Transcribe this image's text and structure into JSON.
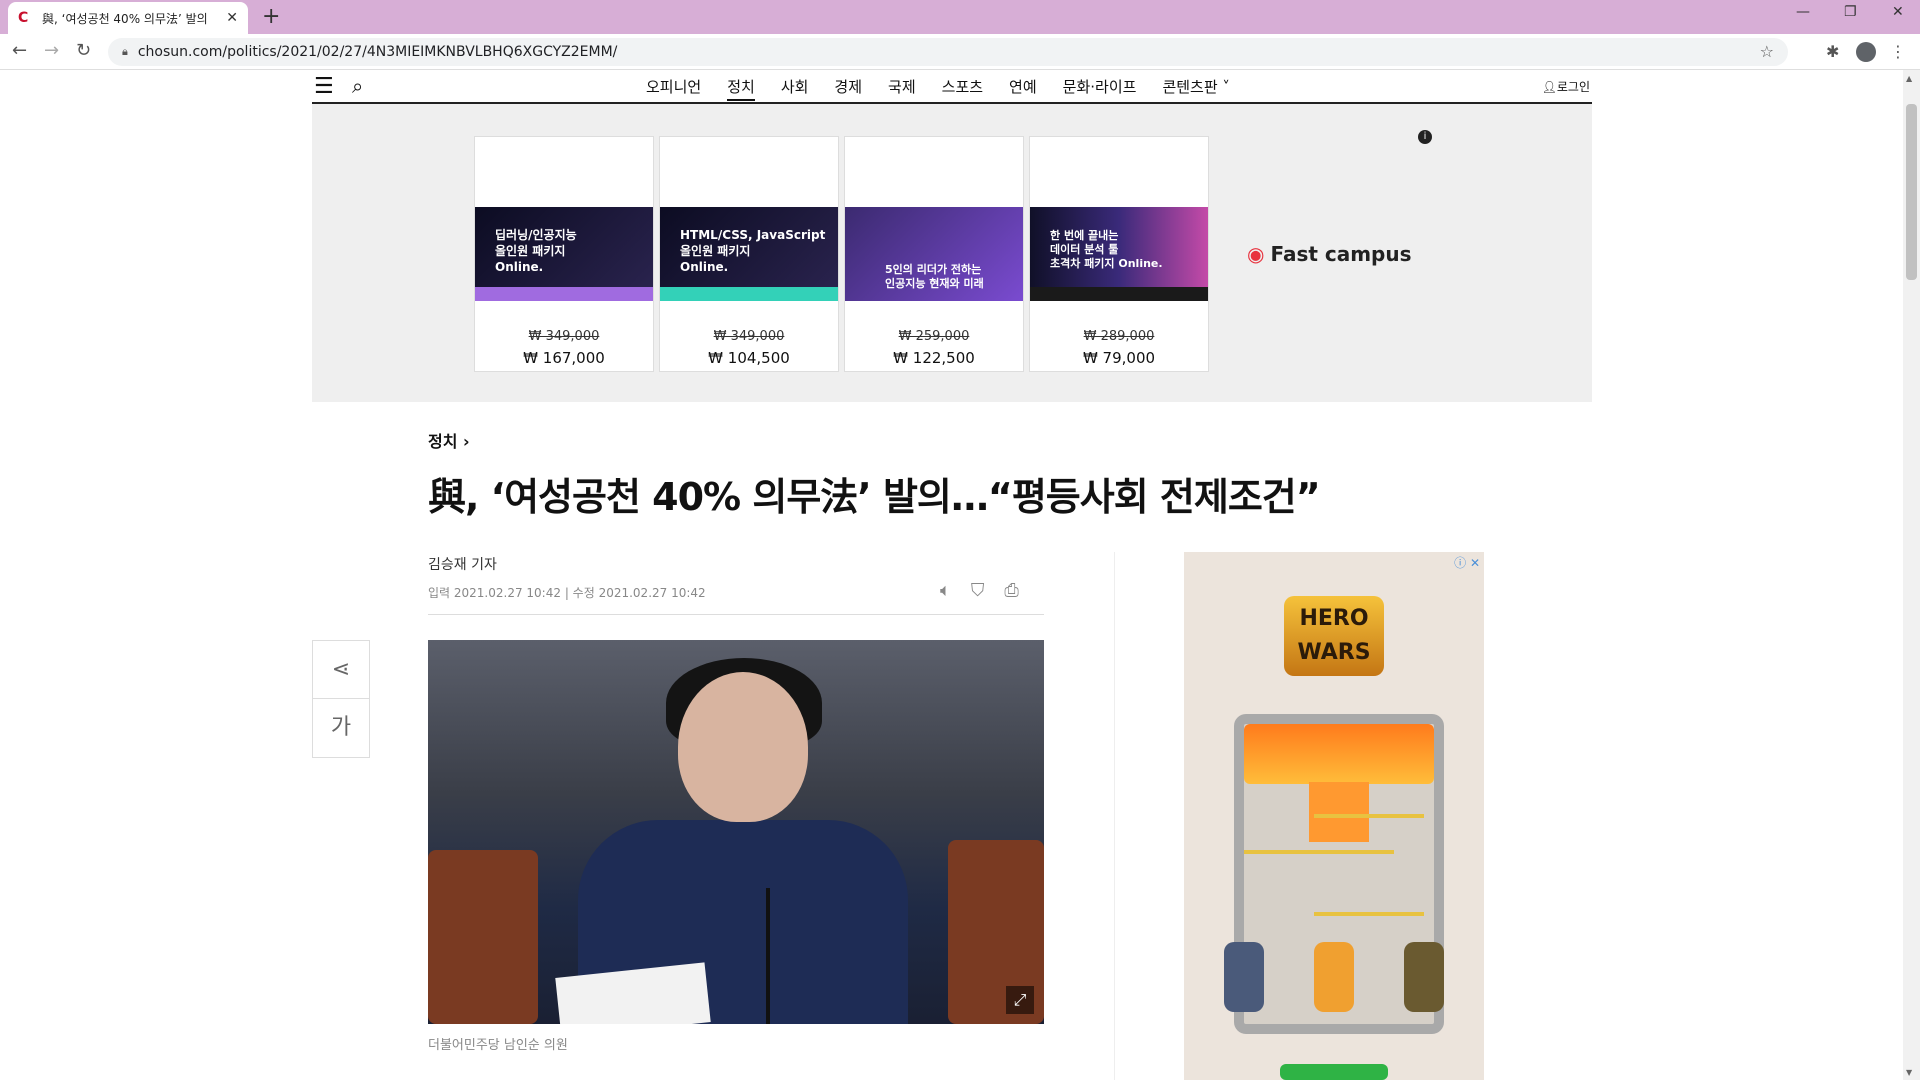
{
  "browser": {
    "tab_title": "與, ‘여성공천 40% 의무法’ 발의",
    "url": "chosun.com/politics/2021/02/27/4N3MIEIMKNBVLBHQ6XGCYZ2EMM/"
  },
  "site_nav": {
    "categories": [
      "오피니언",
      "정치",
      "사회",
      "경제",
      "국제",
      "스포츠",
      "연예",
      "문화·라이프",
      "콘텐츠판"
    ],
    "active": "정치",
    "login_label": "로그인"
  },
  "ad_banner": {
    "brand": "Fast campus",
    "cards": [
      {
        "image_text": "딥러닝/인공지능\n올인원 패키지\nOnline.",
        "accent": "#a06be0",
        "old_price": "₩ 349,000",
        "new_price": "₩ 167,000"
      },
      {
        "image_text": "HTML/CSS, JavaScript\n올인원 패키지\nOnline.",
        "accent": "#33d1b8",
        "old_price": "₩ 349,000",
        "new_price": "₩ 104,500"
      },
      {
        "image_text": "5인의 리더가 전하는\n인공지능 현재와 미래",
        "accent": "#7a4bd0",
        "old_price": "₩ 259,000",
        "new_price": "₩ 122,500"
      },
      {
        "image_text": "한 번에 끝내는\n데이터 분석 툴\n초격차 패키지 Online.",
        "accent": "#1a1a1a",
        "old_price": "₩ 289,000",
        "new_price": "₩ 79,000"
      }
    ]
  },
  "article": {
    "section": "정치",
    "headline": "與, ‘여성공천 40% 의무法’ 발의…“평등사회 전제조건”",
    "byline": "김승재 기자",
    "dates": "입력 2021.02.27 10:42 | 수정 2021.02.27 10:42",
    "caption": "더불어민주당 남인순 의원"
  },
  "side_tools": {
    "font_label": "가"
  },
  "side_ad": {
    "logo_text": "HERO WARS"
  },
  "colors": {
    "tabbar": "#d7aed6",
    "brand_red": "#e8323e"
  }
}
